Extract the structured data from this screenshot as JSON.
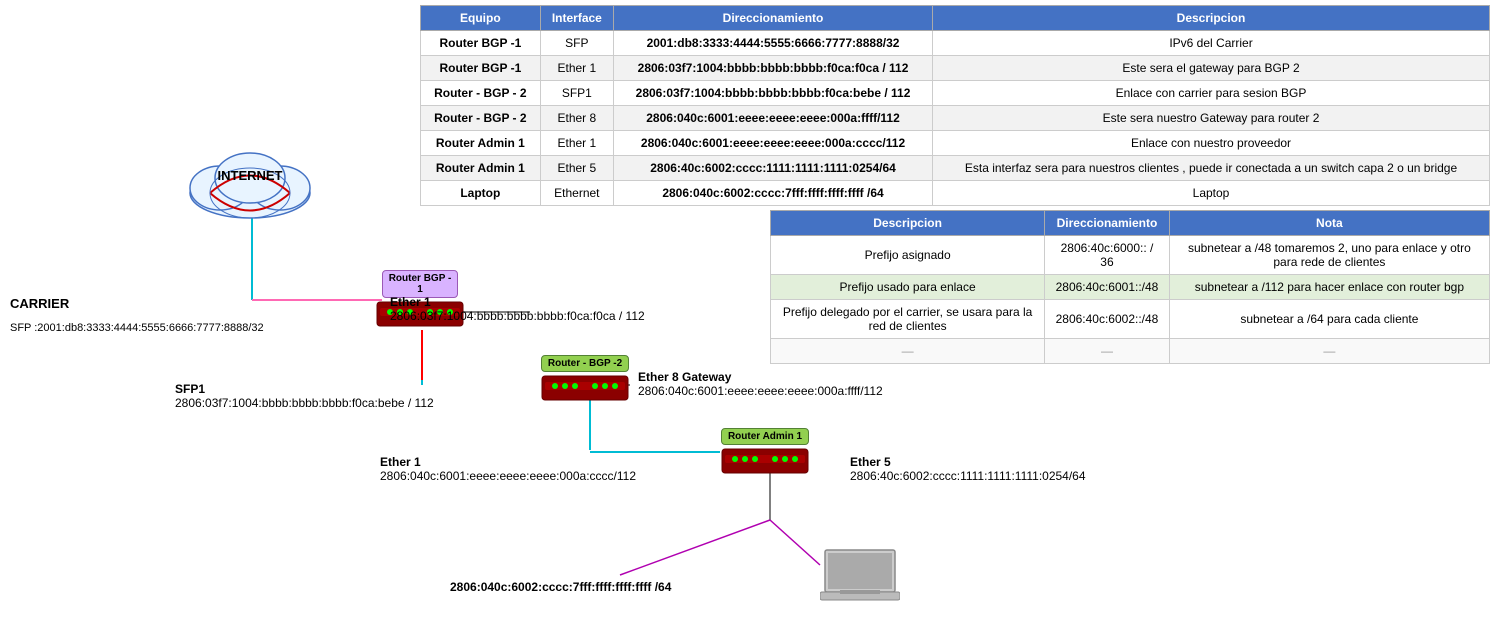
{
  "mainTable": {
    "headers": [
      "Equipo",
      "Interface",
      "Direccionamiento",
      "Descripcion"
    ],
    "rows": [
      {
        "equipo": "Router BGP -1",
        "interface": "SFP",
        "direccionamiento": "2001:db8:3333:4444:5555:6666:7777:8888/32",
        "descripcion": "IPv6 del Carrier"
      },
      {
        "equipo": "Router BGP -1",
        "interface": "Ether 1",
        "direccionamiento": "2806:03f7:1004:bbbb:bbbb:bbbb:f0ca:f0ca / 112",
        "descripcion": "Este sera el gateway para BGP 2"
      },
      {
        "equipo": "Router - BGP - 2",
        "interface": "SFP1",
        "direccionamiento": "2806:03f7:1004:bbbb:bbbb:bbbb:f0ca:bebe / 112",
        "descripcion": "Enlace con carrier para sesion BGP"
      },
      {
        "equipo": "Router - BGP - 2",
        "interface": "Ether 8",
        "direccionamiento": "2806:040c:6001:eeee:eeee:eeee:000a:ffff/112",
        "descripcion": "Este sera nuestro Gateway para router 2"
      },
      {
        "equipo": "Router Admin 1",
        "interface": "Ether 1",
        "direccionamiento": "2806:040c:6001:eeee:eeee:eeee:000a:cccc/112",
        "descripcion": "Enlace con nuestro proveedor"
      },
      {
        "equipo": "Router Admin 1",
        "interface": "Ether 5",
        "direccionamiento": "2806:40c:6002:cccc:1111:1111:1111:0254/64",
        "descripcion": "Esta interfaz sera para nuestros clientes , puede ir conectada a un switch capa 2 o un bridge"
      },
      {
        "equipo": "Laptop",
        "interface": "Ethernet",
        "direccionamiento": "2806:040c:6002:cccc:7fff:ffff:ffff:ffff /64",
        "descripcion": "Laptop"
      }
    ]
  },
  "secondTable": {
    "headers": [
      "Descripcion",
      "Direccionamiento",
      "Nota"
    ],
    "rows": [
      {
        "descripcion": "Prefijo asignado",
        "direccionamiento": "2806:40c:6000:: / 36",
        "nota": "subnetear a /48  tomaremos 2, uno para enlace y otro para rede de clientes"
      },
      {
        "descripcion": "Prefijo usado para enlace",
        "direccionamiento": "2806:40c:6001::/48",
        "nota": "subnetear a /112 para hacer enlace con router bgp"
      },
      {
        "descripcion": "Prefijo delegado por el carrier, se usara para la red de clientes",
        "direccionamiento": "2806:40c:6002::/48",
        "nota": "subnetear a /64 para cada cliente"
      },
      {
        "descripcion": "—",
        "direccionamiento": "—",
        "nota": "—"
      }
    ]
  },
  "diagram": {
    "internetLabel": "INTERNET",
    "carrierLabel": "CARRIER",
    "carrierAddr": "SFP :2001:db8:3333:4444:5555:6666:7777:8888/32",
    "routerBGP1Label": "Router BGP -\n1",
    "routerBGP2Label": "Router - BGP -2",
    "routerAdminLabel": "Router Admin 1",
    "ether1BGPLabel": "Ether 1",
    "ether1BGPAddr": "2806:03f7:1004:bbbb:bbbb:bbbb:f0ca:f0ca / 112",
    "sfp1Label": "SFP1",
    "sfp1Addr": "2806:03f7:1004:bbbb:bbbb:bbbb:f0ca:bebe / 112",
    "ether8Label": "Ether 8 Gateway",
    "ether8Addr": "2806:040c:6001:eeee:eeee:eeee:000a:ffff/112",
    "ether1AdminLabel": "Ether 1",
    "ether1AdminAddr": "2806:040c:6001:eeee:eeee:eeee:000a:cccc/112",
    "ether5Label": "Ether 5",
    "ether5Addr": "2806:40c:6002:cccc:1111:1111:1111:0254/64",
    "laptopAddr": "2806:040c:6002:cccc:7fff:ffff:ffff:ffff /64"
  }
}
